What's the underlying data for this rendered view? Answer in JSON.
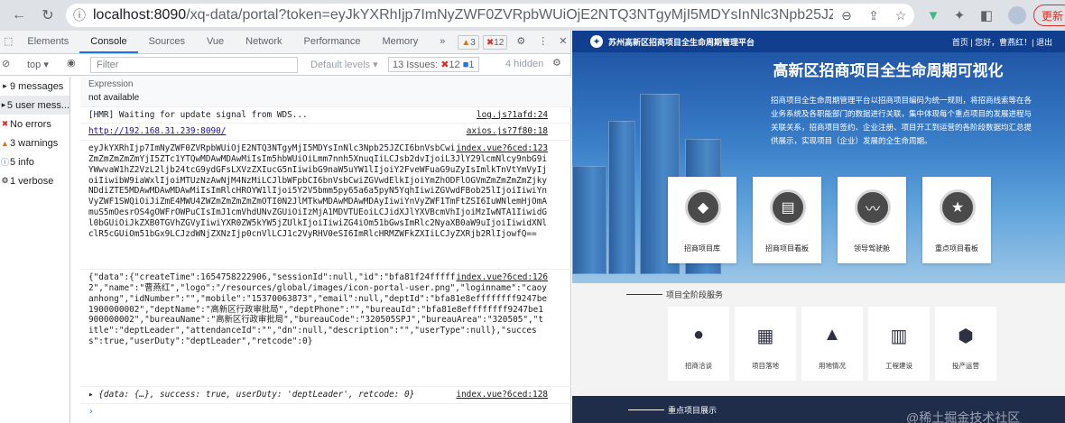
{
  "browser": {
    "url_host": "localhost:8090",
    "url_path": "/xq-data/portal?token=eyJkYXRhIjp7ImNyZWF0ZVRpbWUiOjE2NTQ3NTgyMjI5MDYsInNlc3Npb25JZCI6bn",
    "update_label": "更新"
  },
  "devtools": {
    "tabs": [
      "Elements",
      "Console",
      "Sources",
      "Vue",
      "Network",
      "Performance",
      "Memory",
      "»"
    ],
    "warn_count": "3",
    "error_count": "12",
    "toolbar": {
      "context": "top",
      "filter_placeholder": "Filter",
      "levels": "Default levels",
      "issues_label": "13 Issues:",
      "issues_errors": "12",
      "issues_info": "1",
      "hidden": "4 hidden"
    },
    "sidebar": [
      {
        "label": "9 messages",
        "icon": "list-icon"
      },
      {
        "label": "5 user mess...",
        "icon": "user-icon"
      },
      {
        "label": "No errors",
        "icon": "error-icon"
      },
      {
        "label": "3 warnings",
        "icon": "warning-icon"
      },
      {
        "label": "5 info",
        "icon": "info-icon"
      },
      {
        "label": "1 verbose",
        "icon": "verbose-icon"
      }
    ],
    "console": {
      "expression_label": "Expression",
      "expression_value": "not available",
      "hmr_text": "[HMR] Waiting for update signal from WDS...",
      "hmr_source": "log.js?1afd:24",
      "url_text": "http://192.168.31.239:8090/",
      "url_source": "axios.js?7f80:18",
      "token_text": "eyJkYXRhIjp7ImNyZWF0ZVRpbWUiOjE2NTQ3NTgyMjI5MDYsInNlc3Npb25JZCI6bnVsbCwiaWQiOiJiZmE4MWYyNGZmZmZmZmZmYjI5ZTc1YTQwMDAwMDAwMiIsIm5hbWUiOiLmm7nnh5XnuqIiLCJsb2dvIjoiL3JlY29lcmNlcy9nbG9iYWwvaW1hZ2VzL2ljb24tcG9ydGFsLXVzZXIucG5nIiwibG9naW5uYW1lIjoiY2FveWFuaG9uZyIsImlkTnVtYmVyIjoiIiwibW9iaWxlIjoiMTUzNzAwNjM4NzMiLCJlbWFpbCI6bnVsbCwiZGVwdElkIjoiYmZhODFlOGVmZmZmZmZmZjkyNDdiZTE5MDAwMDAwMDAwMiIsImRlcHROYW1lIjoi5Y2V5bmm5py65a6a5pyN5YqhIiwiZGVwdFBob25lIjoiIiwiYnVyZWF1SWQiOiJiZmE4MWU4ZWZmZmZmZmZmOTI0N2JlMTkwMDAwMDAwMDAyIiwiYnVyZWF1TmFtZSI6IuWNlemHjOmAmuS5mOesrOS4gOWFrOWPuCIsImJ1cmVhdUNvZGUiOiIzMjA1MDVTUEoiLCJidXJlYXVBcmVhIjoiMzIwNTA1IiwidGl0bGUiOiJkZXB0TGVhZGVyIiwiYXR0ZW5kYW5jZUlkIjoiIiwiZG4iOm51bGwsImRlc2NyaXB0aW9uIjoiIiwidXNlclR5cGUiOm51bGx9LCJzdWNjZXNzIjp0cnVlLCJ1c2VyRHV0eSI6ImRlcHRMZWFkZXIiLCJyZXRjb2RlIjowfQ==",
      "token_source": "index.vue?6ced:123",
      "data_text": "{\"data\":{\"createTime\":1654758222906,\"sessionId\":null,\"id\":\"bfa81f24ffffffffb29e75a400000002\",\"name\":\"曹燕红\",\"logo\":\"/resources/global/images/icon-portal-user.png\",\"loginname\":\"caoyanhong\",\"idNumber\":\"\",\"mobile\":\"15370063873\",\"email\":null,\"deptId\":\"bfa81e8effffffff9247be1900000002\",\"deptName\":\"高新区行政审批局\",\"deptPhone\":\"\",\"bureauId\":\"bfa81e8effffffff9247be1900000002\",\"bureauName\":\"高新区行政审批局\",\"bureauCode\":\"320505SPJ\",\"bureauArea\":\"320505\",\"title\":\"deptLeader\",\"attendanceId\":\"\",\"dn\":null,\"description\":\"\",\"userType\":null},\"success\":true,\"userDuty\":\"deptLeader\",\"retcode\":0}",
      "data_source": "index.vue?6ced:126",
      "obj_text": "▸ {data: {…}, success: true, userDuty: 'deptLeader', retcode: 0}",
      "obj_source": "index.vue?6ced:128",
      "prompt": "›"
    }
  },
  "app": {
    "site_name": "苏州高新区招商项目全生命周期管理平台",
    "nav": "首页 | 您好，曹燕红！| 退出",
    "hero_title": "高新区招商项目全生命周期可视化",
    "hero_desc": "招商项目全生命周期管理平台以招商项目编码为统一规则，将招商线索等在各业务系统及各职能部门的数据进行关联，集中体现每个重点项目的发展进程与关联关系，招商项目签约、企业注册、项目开工到运营的各阶段数据均汇总提供展示，实现项目（企业）发展的全生命周期。",
    "cards": [
      "招商项目库",
      "招商项目看板",
      "领导驾驶舱",
      "重点项目看板"
    ],
    "section_title": "项目全阶段服务",
    "services": [
      "招商洽谈",
      "项目落地",
      "用地情况",
      "工程建设",
      "投产运营"
    ],
    "footer_title": "重点项目展示",
    "watermark": "@稀土掘金技术社区"
  }
}
